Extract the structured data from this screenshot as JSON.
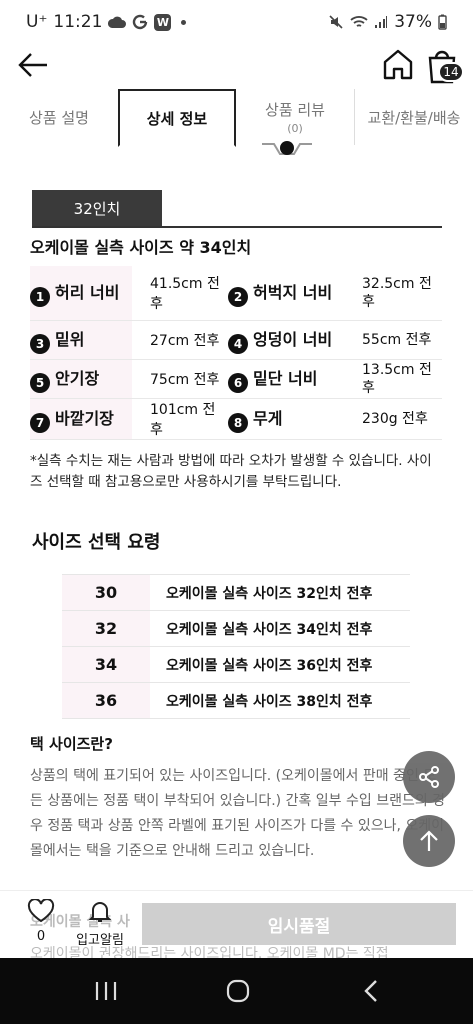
{
  "status": {
    "carrier": "U⁺",
    "time": "11:21",
    "app_badge": "W",
    "battery": "37%"
  },
  "header": {
    "cart_count": "14"
  },
  "tabs": [
    {
      "label": "상품 설명"
    },
    {
      "label": "상세 정보"
    },
    {
      "label": "상품 리뷰",
      "sub": "(0)"
    },
    {
      "label": "교환/환불/배송"
    }
  ],
  "size": {
    "tag": "32인치",
    "headline": "오케이몰 실측 사이즈 약 34인치"
  },
  "measurements": [
    {
      "n1": "1",
      "l1": "허리 너비",
      "v1": "41.5cm 전후",
      "n2": "2",
      "l2": "허벅지 너비",
      "v2": "32.5cm 전후"
    },
    {
      "n1": "3",
      "l1": "밑위",
      "v1": "27cm 전후",
      "n2": "4",
      "l2": "엉덩이 너비",
      "v2": "55cm 전후"
    },
    {
      "n1": "5",
      "l1": "안기장",
      "v1": "75cm 전후",
      "n2": "6",
      "l2": "밑단 너비",
      "v2": "13.5cm 전후"
    },
    {
      "n1": "7",
      "l1": "바깥기장",
      "v1": "101cm 전후",
      "n2": "8",
      "l2": "무게",
      "v2": "230g 전후"
    }
  ],
  "notice": "*실측 수치는 재는 사람과 방법에 따라 오차가 발생할 수 있습니다. 사이즈 선택할 때 참고용으로만 사용하시기를 부탁드립니다.",
  "guide": {
    "title": "사이즈 선택 요령",
    "rows": [
      {
        "size": "30",
        "desc": "오케이몰 실측 사이즈 32인치 전후"
      },
      {
        "size": "32",
        "desc": "오케이몰 실측 사이즈 34인치 전후"
      },
      {
        "size": "34",
        "desc": "오케이몰 실측 사이즈 36인치 전후"
      },
      {
        "size": "36",
        "desc": "오케이몰 실측 사이즈 38인치 전후"
      }
    ]
  },
  "tag_info": {
    "title": "택 사이즈란?",
    "body": "상품의 택에 표기되어 있는 사이즈입니다. (오케이몰에서 판매 중인 모든 상품에는 정품 택이 부착되어 있습니다.) 간혹 일부 수입 브랜드의 경우 정품 택과 상품 안쪽 라벨에 표기된 사이즈가 다를 수 있으나, 오케이몰에서는 택을 기준으로 안내해 드리고 있습니다."
  },
  "behind": {
    "title": "오케이몰 실측 사",
    "body": "오케이몰이 권장해드리는 사이즈입니다. 오케이몰 MD는 직접"
  },
  "bottom": {
    "like_count": "0",
    "alarm_label": "입고알림",
    "buy_label": "임시품절"
  }
}
